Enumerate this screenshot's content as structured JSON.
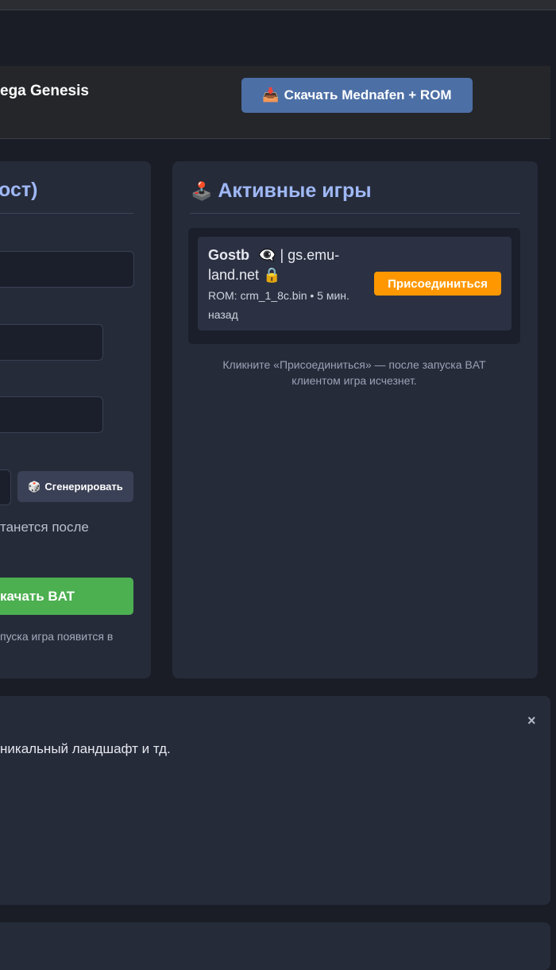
{
  "header": {
    "title": "ega Genesis",
    "download_label": "Скачать Mednafen + ROM",
    "download_icon": "inbox-tray-icon"
  },
  "left_card": {
    "title": "ост)",
    "generate_label": "Сгенерировать",
    "generate_icon": "dice-icon",
    "note": "танется после",
    "start_label": "качать BAT",
    "after_start_note": "пуска игра появится в"
  },
  "right_card": {
    "title": "Активные игры",
    "title_icon": "joystick-icon",
    "games": [
      {
        "host": "Gostb",
        "server": "gs.emu-",
        "server_cont": "land.net",
        "rom": "ROM: crm_1_8c.bin • 5 мин.",
        "rom_cont": "назад",
        "join_label": "Присоединиться"
      }
    ],
    "hint_line1": "Кликните «Присоединиться» — после запуска BAT",
    "hint_line2": "клиентом игра исчезнет."
  },
  "info_panel": {
    "text": "никальный ландшафт и тд.",
    "close_label": "×"
  },
  "colors": {
    "accent": "#9fb8f5",
    "download_button": "#4c6fa5",
    "start_button": "#4caf50",
    "join_button": "#ff9800"
  }
}
